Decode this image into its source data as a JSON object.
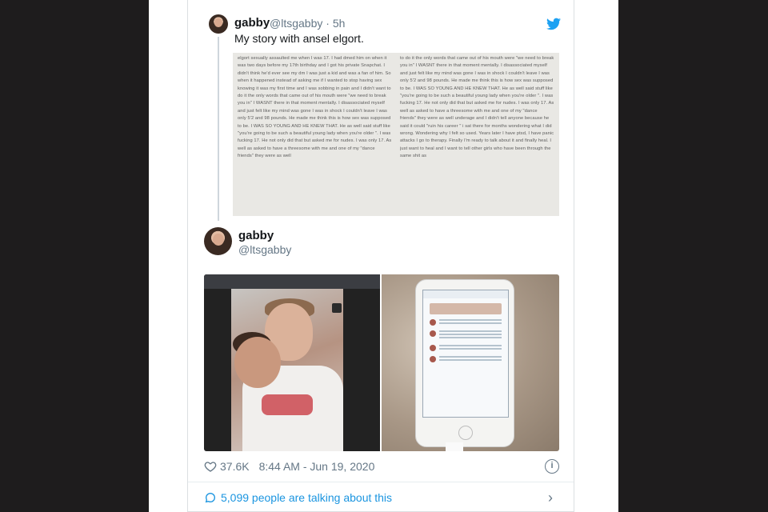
{
  "tweet": {
    "display_name": "gabby",
    "handle": "@ltsgabby",
    "age": "5h",
    "text": "My story with ansel elgort.",
    "image_text_left": "elgort sexually assaulted me when I was 17. I had dmed him on when it was two days before my 17th birthday and I got his private Snapchat. I didn't think he'd ever see my dm I was just a kid and was a fan of him. So when it happened instead of asking me if I wanted to stop having sex knowing it was my first time and I was sobbing in pain and I didn't want to do it the only words that came out of his mouth were \"we need to break you in\" I WASNT there in that moment mentally. I disassociated myself and just felt like my mind was gone I was in shock I couldn't leave I was only 5'2 and 98 pounds. He made me think this is how sex was supposed to be. I WAS SO YOUNG AND HE KNEW THAT. He as well said stuff like \"you're going to be such a beautiful young lady when you're older \". I was fucking 17. He not only did that but asked me for nudes. I was only 17. As well as asked to have a threesome with me and one of my \"dance friends\" they were as well",
    "image_text_right": "to do it the only words that came out of his mouth were \"we need to break you in\" I WASNT there in that moment mentally. I disassociated myself and just felt like my mind was gone I was in shock I couldn't leave I was only 5'2 and 98 pounds. He made me think this is how sex was supposed to be. I WAS SO YOUNG AND HE KNEW THAT. He as well said stuff like \"you're going to be such a beautiful young lady when you're older \". I was fucking 17. He not only did that but asked me for nudes. I was only 17. As well as asked to have a threesome with me and one of my \"dance friends\" they were as well underage and I didn't tell anyone because he said it could \"ruin his career \" i sat there for months wondering what I did wrong. Wondering why I felt so used. Years later I have ptsd, I have panic attacks I go to therapy. Finally I'm ready to talk about it and finally heal. I just want to heal and I want to tell other girls who have been through the same shit as"
  },
  "reply": {
    "display_name": "gabby",
    "handle": "@ltsgabby"
  },
  "footer": {
    "likes": "37.6K",
    "timestamp": "8:44 AM - Jun 19, 2020",
    "info": "i",
    "talking": "5,099 people are talking about this",
    "chevron": "›"
  },
  "colors": {
    "twitter_blue": "#1da1f2",
    "link_blue": "#1b95e0",
    "muted": "#657786"
  },
  "icons": [
    "twitter-bird-icon",
    "heart-icon",
    "info-icon",
    "speech-bubble-icon",
    "chevron-right-icon"
  ]
}
